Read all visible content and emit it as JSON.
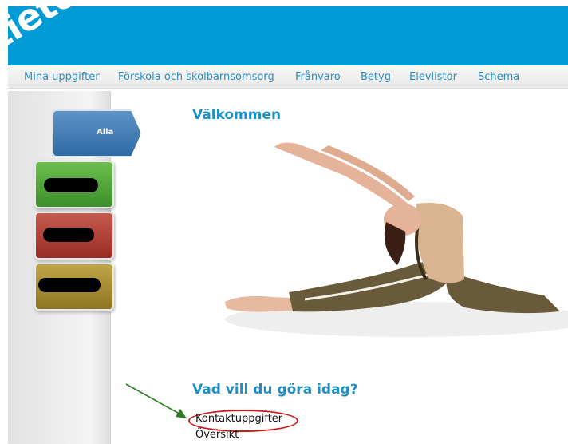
{
  "header": {
    "logo_text": "tieto",
    "bg_color": "#009ad6"
  },
  "nav": {
    "items": [
      "Mina uppgifter",
      "Förskola och skolbarnsomsorg",
      "Frånvaro",
      "Betyg",
      "Elevlistor",
      "Schema"
    ],
    "color": "#2a8fc4"
  },
  "sidebar": {
    "alla_label": "Alla",
    "buttons": [
      {
        "color": "green"
      },
      {
        "color": "red"
      },
      {
        "color": "olive"
      }
    ]
  },
  "main": {
    "welcome": "Välkommen",
    "question": "Vad vill du göra idag?",
    "links": [
      "Kontaktuppgifter",
      "Översikt"
    ],
    "accent_color": "#1f8fc4",
    "highlight_color": "#d01a1a",
    "arrow_color": "#2e7d22"
  }
}
